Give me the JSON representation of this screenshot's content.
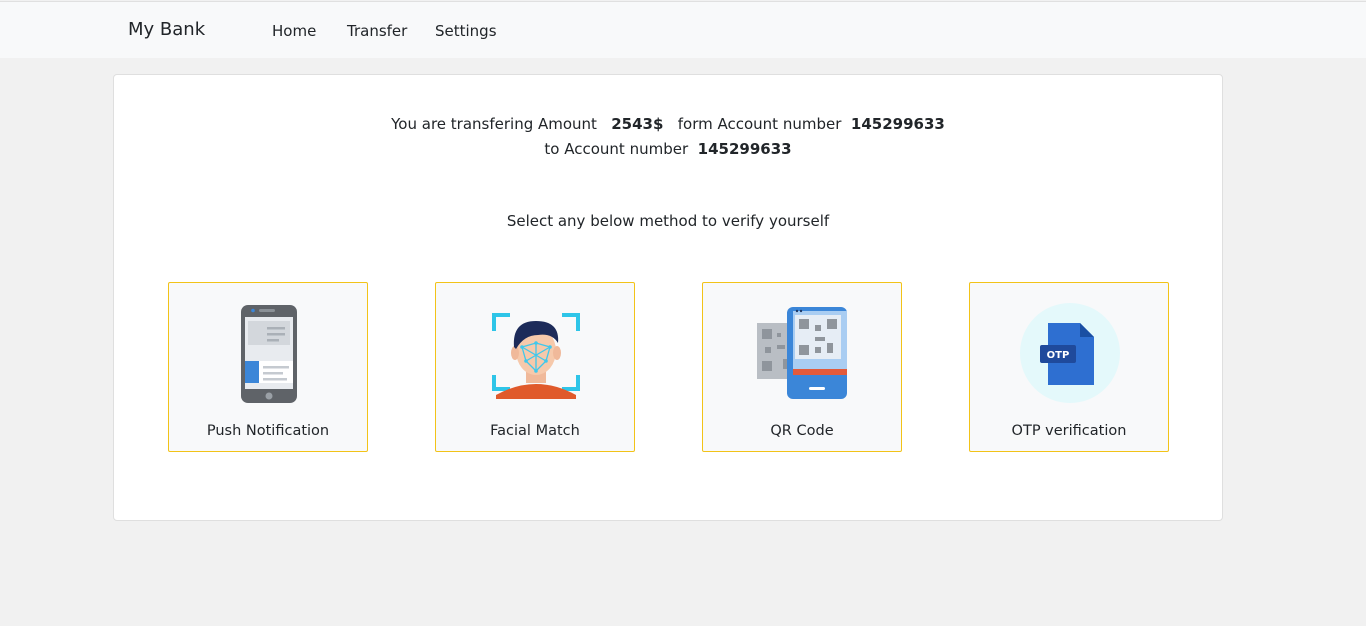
{
  "navbar": {
    "brand": "My Bank",
    "links": [
      "Home",
      "Transfer",
      "Settings"
    ]
  },
  "transfer": {
    "prefix": "You are transfering Amount",
    "amount": "2543$",
    "from_label": "form Account number",
    "from_account": "145299633",
    "to_label": "to Account number",
    "to_account": "145299633"
  },
  "instruction": "Select any below method to verify yourself",
  "methods": [
    {
      "label": "Push Notification",
      "icon": "phone-notification-icon"
    },
    {
      "label": "Facial Match",
      "icon": "face-scan-icon"
    },
    {
      "label": "QR Code",
      "icon": "qr-code-icon"
    },
    {
      "label": "OTP verification",
      "icon": "otp-file-icon"
    }
  ],
  "colors": {
    "method_border": "#f2c318",
    "accent_blue": "#3b86d8"
  }
}
